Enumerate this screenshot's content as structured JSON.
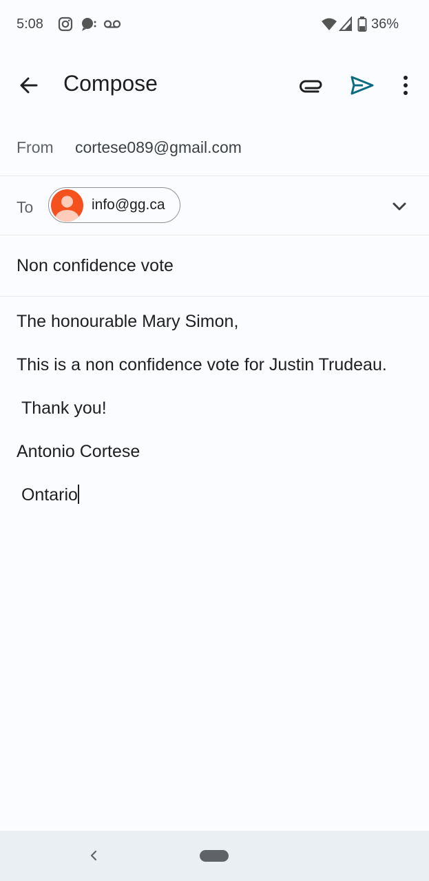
{
  "status_bar": {
    "time": "5:08",
    "battery": "36%",
    "icons": [
      "instagram-icon",
      "chat-bubble-icon",
      "voicemail-icon",
      "wifi-icon",
      "signal-icon",
      "battery-icon"
    ]
  },
  "app_bar": {
    "title": "Compose",
    "icons": [
      "back-arrow-icon",
      "attachment-icon",
      "send-icon",
      "more-vert-icon"
    ],
    "send_color": "#0b6b80"
  },
  "from": {
    "label": "From",
    "value": "cortese089@gmail.com"
  },
  "to": {
    "label": "To",
    "chip_text": "info@gg.ca",
    "avatar_color": "#f4511e"
  },
  "subject": "Non confidence vote",
  "body": {
    "line1": "The honourable Mary Simon,",
    "line2": "This is a non confidence vote for Justin Trudeau.",
    "line3": " Thank you!",
    "line4": "Antonio Cortese",
    "line5": " Ontario"
  },
  "nav_bar": {
    "icons": [
      "nav-back-icon",
      "home-pill-icon"
    ]
  }
}
